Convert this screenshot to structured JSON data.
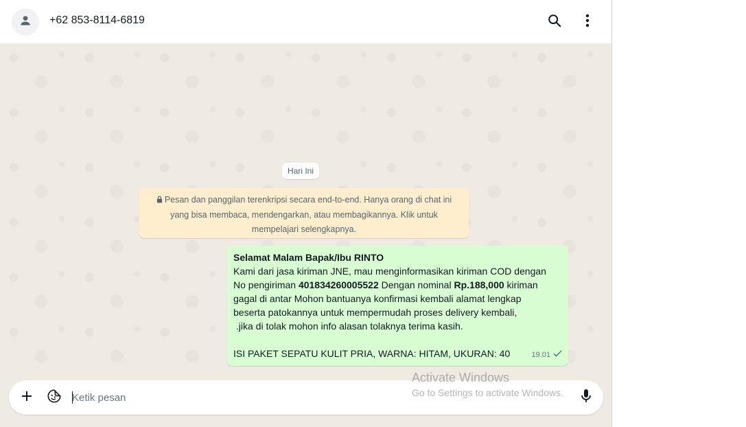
{
  "header": {
    "contact_name": "+62 853-8114-6819",
    "avatar_icon": "default-person-icon",
    "search_icon": "search-icon",
    "menu_icon": "more-vertical-icon"
  },
  "chat": {
    "day_label": "Hari Ini",
    "encryption_notice": "Pesan dan panggilan terenkripsi secara end-to-end. Hanya orang di chat ini yang bisa membaca, mendengarkan, atau membagikannya. Klik untuk mempelajari selengkapnya.",
    "message": {
      "greeting": "Selamat Malam Bapak/Ibu RINTO",
      "line1": "Kami dari jasa kiriman JNE, mau menginformasikan kiriman COD dengan",
      "part_no_label": "No pengiriman ",
      "tracking_number": "401834260005522",
      "part_nominal_label": " Dengan nominal ",
      "amount": "Rp.188,000",
      "part_after_amount": " kiriman",
      "line3": "gagal di antar Mohon bantuanya konfirmasi kembali alamat lengkap",
      "line4": "beserta patokannya untuk mempermudah proses delivery kembali,",
      "line5": " .jika di tolak mohon info alasan tolaknya terima kasih.",
      "package_line": "ISI PAKET SEPATU KULIT PRIA, WARNA: HITAM, UKURAN: 40",
      "time": "19.01",
      "status_icon": "single-check-icon"
    }
  },
  "composer": {
    "attach_icon": "plus-icon",
    "sticker_icon": "sticker-icon",
    "placeholder": "Ketik pesan",
    "mic_icon": "microphone-icon"
  },
  "watermark": {
    "title": "Activate Windows",
    "subtitle": "Go to Settings to activate Windows."
  },
  "colors": {
    "chat_background": "#efeae2",
    "outgoing_bubble": "#d9fdd3",
    "notice_background": "#ffeecd",
    "header_background": "#ffffff"
  }
}
